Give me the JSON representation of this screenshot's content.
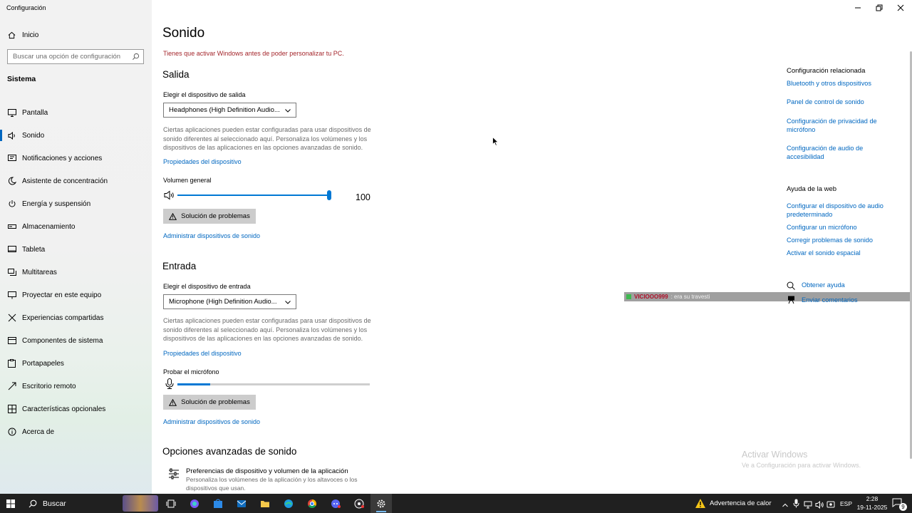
{
  "window": {
    "title": "Configuración"
  },
  "sidebar": {
    "home_label": "Inicio",
    "search_placeholder": "Buscar una opción de configuración",
    "section": "Sistema",
    "items": [
      {
        "label": "Pantalla",
        "icon": "monitor-icon"
      },
      {
        "label": "Sonido",
        "icon": "speaker-icon",
        "active": true
      },
      {
        "label": "Notificaciones y acciones",
        "icon": "notification-icon"
      },
      {
        "label": "Asistente de concentración",
        "icon": "moon-icon"
      },
      {
        "label": "Energía y suspensión",
        "icon": "power-icon"
      },
      {
        "label": "Almacenamiento",
        "icon": "storage-icon"
      },
      {
        "label": "Tableta",
        "icon": "tablet-icon"
      },
      {
        "label": "Multitareas",
        "icon": "multitask-icon"
      },
      {
        "label": "Proyectar en este equipo",
        "icon": "project-icon"
      },
      {
        "label": "Experiencias compartidas",
        "icon": "shared-icon"
      },
      {
        "label": "Componentes de sistema",
        "icon": "components-icon"
      },
      {
        "label": "Portapapeles",
        "icon": "clipboard-icon"
      },
      {
        "label": "Escritorio remoto",
        "icon": "remote-icon"
      },
      {
        "label": "Características opcionales",
        "icon": "features-icon"
      },
      {
        "label": "Acerca de",
        "icon": "info-icon"
      }
    ]
  },
  "main": {
    "title": "Sonido",
    "activation_warning": "Tienes que activar Windows antes de poder personalizar tu PC.",
    "output": {
      "heading": "Salida",
      "choose_label": "Elegir el dispositivo de salida",
      "device": "Headphones (High Definition Audio...",
      "description": "Ciertas aplicaciones pueden estar configuradas para usar dispositivos de sonido diferentes al seleccionado aquí. Personaliza los volúmenes y los dispositivos de las aplicaciones en las opciones avanzadas de sonido.",
      "properties_link": "Propiedades del dispositivo",
      "volume_label": "Volumen general",
      "volume_value": "100",
      "volume_level": 1.0,
      "troubleshoot": "Solución de problemas",
      "manage_link": "Administrar dispositivos de sonido"
    },
    "input": {
      "heading": "Entrada",
      "choose_label": "Elegir el dispositivo de entrada",
      "device": "Microphone (High Definition Audio...",
      "description": "Ciertas aplicaciones pueden estar configuradas para usar dispositivos de sonido diferentes al seleccionado aquí. Personaliza los volúmenes y los dispositivos de las aplicaciones en las opciones avanzadas de sonido.",
      "properties_link": "Propiedades del dispositivo",
      "test_label": "Probar el micrófono",
      "mic_level": 0.17,
      "troubleshoot": "Solución de problemas",
      "manage_link": "Administrar dispositivos de sonido"
    },
    "advanced": {
      "heading": "Opciones avanzadas de sonido",
      "item_title": "Preferencias de dispositivo y volumen de la aplicación",
      "item_desc": "Personaliza los volúmenes de la aplicación y los altavoces o los dispositivos que usan."
    }
  },
  "related": {
    "heading": "Configuración relacionada",
    "links": [
      "Bluetooth y otros dispositivos",
      "Panel de control de sonido",
      "Configuración de privacidad de micrófono",
      "Configuración de audio de accesibilidad"
    ],
    "web_heading": "Ayuda de la web",
    "web_links": [
      "Configurar el dispositivo de audio predeterminado",
      "Configurar un micrófono",
      "Corregir problemas de sonido",
      "Activar el sonido espacial"
    ],
    "get_help": "Obtener ayuda",
    "feedback": "Enviar comentarios"
  },
  "overlay": {
    "user": "VICIOOO999",
    "message": ": era su travesti"
  },
  "watermark": {
    "line1": "Activar Windows",
    "line2": "Ve a Configuración para activar Windows."
  },
  "taskbar": {
    "search_placeholder": "Buscar",
    "weather": "Advertencia de calor",
    "language": "ESP",
    "time": "2:28",
    "date": "19-11-2025",
    "notifications": "9"
  },
  "colors": {
    "accent": "#0078d4",
    "link": "#0067c0",
    "warning": "#a4262c"
  }
}
